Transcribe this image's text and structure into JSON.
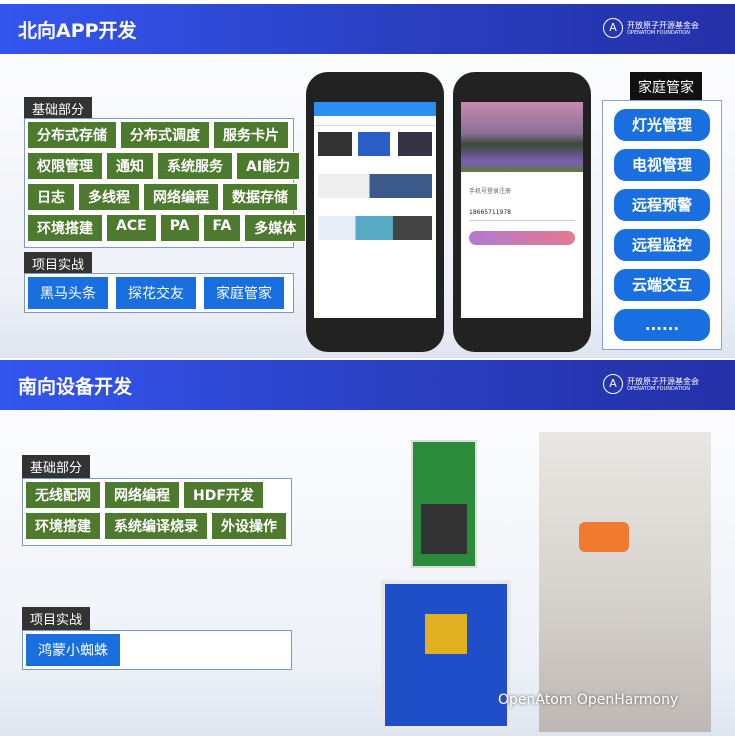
{
  "north": {
    "title": "北向APP开发",
    "logo_cn": "开放原子开源基金会",
    "logo_en": "OPENATOM FOUNDATION",
    "basics_label": "基础部分",
    "basics_rows": [
      [
        "分布式存储",
        "分布式调度",
        "服务卡片"
      ],
      [
        "权限管理",
        "通知",
        "系统服务",
        "AI能力"
      ],
      [
        "日志",
        "多线程",
        "网络编程",
        "数据存储"
      ],
      [
        "环境搭建",
        "ACE",
        "PA",
        "FA",
        "多媒体"
      ]
    ],
    "projects_label": "项目实战",
    "projects": [
      "黑马头条",
      "探花交友",
      "家庭管家"
    ],
    "phone2": {
      "login_title": "手机号登录注册",
      "phone_number": "18665711978"
    },
    "home": {
      "label": "家庭管家",
      "items": [
        "灯光管理",
        "电视管理",
        "远程预警",
        "远程监控",
        "云端交互",
        "......"
      ]
    }
  },
  "south": {
    "title": "南向设备开发",
    "logo_cn": "开放原子开源基金会",
    "logo_en": "OPENATOM FOUNDATION",
    "basics_label": "基础部分",
    "basics_rows": [
      [
        "无线配网",
        "网络编程",
        "HDF开发"
      ],
      [
        "环境搭建",
        "系统编译烧录",
        "外设操作"
      ]
    ],
    "projects_label": "项目实战",
    "projects": [
      "鸿蒙小蜘蛛"
    ],
    "watermark": "OpenAtom OpenHarmony"
  },
  "colors": {
    "band": "#2a3fc0",
    "green": "#4e7a2f",
    "blue": "#1a6fe0"
  }
}
